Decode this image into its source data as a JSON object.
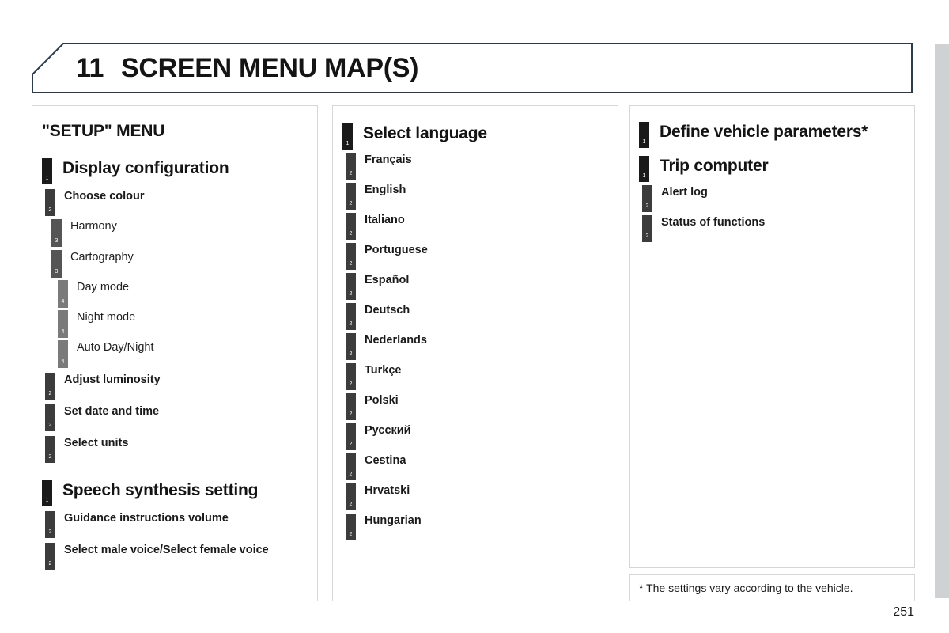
{
  "header": {
    "chapter_number": "11",
    "chapter_title": "SCREEN MENU MAP(S)",
    "border_color": "#2c3a4a"
  },
  "page_number": "251",
  "footnote": {
    "text": "* The settings vary according to the vehicle."
  },
  "colors": {
    "level_1": "#1a1a1a",
    "level_2": "#3c3c3c",
    "level_3": "#555555",
    "level_4": "#7a7a7a",
    "box_border": "#d6d6d6",
    "page_edge": "#d0d1d3"
  },
  "columns": [
    {
      "id": "col-1",
      "heading": "\"SETUP\" MENU",
      "entries": [
        {
          "level": 1,
          "marker": "1",
          "label": "Display configuration"
        },
        {
          "level": 2,
          "marker": "2",
          "label": "Choose colour"
        },
        {
          "level": 3,
          "marker": "3",
          "label": "Harmony"
        },
        {
          "level": 3,
          "marker": "3",
          "label": "Cartography"
        },
        {
          "level": 4,
          "marker": "4",
          "label": "Day mode"
        },
        {
          "level": 4,
          "marker": "4",
          "label": "Night mode"
        },
        {
          "level": 4,
          "marker": "4",
          "label": "Auto Day/Night"
        },
        {
          "level": 2,
          "marker": "2",
          "label": "Adjust luminosity"
        },
        {
          "level": 2,
          "marker": "2",
          "label": "Set date and time"
        },
        {
          "level": 2,
          "marker": "2",
          "label": "Select units"
        },
        {
          "level": 1,
          "marker": "1",
          "label": "Speech synthesis setting"
        },
        {
          "level": 2,
          "marker": "2",
          "label": "Guidance instructions volume"
        },
        {
          "level": 2,
          "marker": "2",
          "label": "Select male voice/Select female voice"
        }
      ]
    },
    {
      "id": "col-2",
      "heading": "",
      "entries": [
        {
          "level": 1,
          "marker": "1",
          "label": "Select language"
        },
        {
          "level": 2,
          "marker": "2",
          "label": "Français"
        },
        {
          "level": 2,
          "marker": "2",
          "label": "English"
        },
        {
          "level": 2,
          "marker": "2",
          "label": "Italiano"
        },
        {
          "level": 2,
          "marker": "2",
          "label": "Portuguese"
        },
        {
          "level": 2,
          "marker": "2",
          "label": "Español"
        },
        {
          "level": 2,
          "marker": "2",
          "label": "Deutsch"
        },
        {
          "level": 2,
          "marker": "2",
          "label": "Nederlands"
        },
        {
          "level": 2,
          "marker": "2",
          "label": "Turkçe"
        },
        {
          "level": 2,
          "marker": "2",
          "label": "Polski"
        },
        {
          "level": 2,
          "marker": "2",
          "label": "Русский"
        },
        {
          "level": 2,
          "marker": "2",
          "label": "Cestina"
        },
        {
          "level": 2,
          "marker": "2",
          "label": "Hrvatski"
        },
        {
          "level": 2,
          "marker": "2",
          "label": "Hungarian"
        }
      ]
    },
    {
      "id": "col-3",
      "heading": "",
      "entries": [
        {
          "level": 1,
          "marker": "1",
          "label": "Define vehicle parameters*"
        },
        {
          "level": 1,
          "marker": "1",
          "label": "Trip computer"
        },
        {
          "level": 2,
          "marker": "2",
          "label": "Alert log"
        },
        {
          "level": 2,
          "marker": "2",
          "label": "Status of functions"
        }
      ]
    }
  ]
}
